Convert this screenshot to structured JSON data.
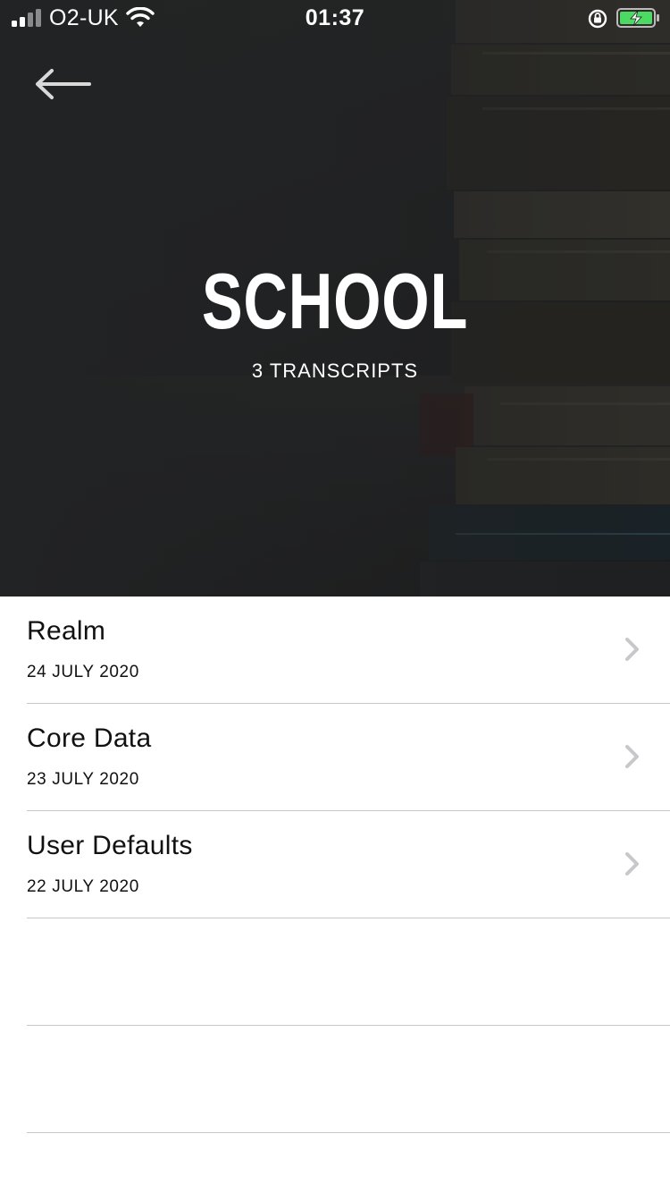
{
  "status_bar": {
    "carrier": "O2-UK",
    "time": "01:37",
    "icons": [
      "signal-icon",
      "wifi-icon",
      "rotation-lock-icon",
      "battery-charging-icon"
    ],
    "battery_color": "#4cd964"
  },
  "header": {
    "back_icon": "arrow-left-icon",
    "title": "SCHOOL",
    "subtitle": "3 TRANSCRIPTS"
  },
  "transcripts": [
    {
      "title": "Realm",
      "date": "24 JULY 2020"
    },
    {
      "title": "Core Data",
      "date": "23 JULY 2020"
    },
    {
      "title": "User Defaults",
      "date": "22 JULY 2020"
    }
  ],
  "colors": {
    "hero_background": "#272829",
    "separator": "#c8c8cc",
    "chevron": "#c7c7cc",
    "text_dark": "#111111"
  }
}
